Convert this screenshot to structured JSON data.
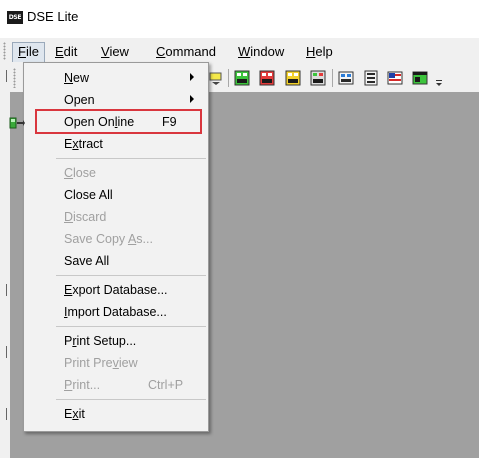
{
  "window": {
    "logo_text": "DSE",
    "title": "DSE Lite"
  },
  "menubar": {
    "items": [
      {
        "label": "File",
        "mnemonic": "F"
      },
      {
        "label": "Edit",
        "mnemonic": "E"
      },
      {
        "label": "View",
        "mnemonic": "V"
      },
      {
        "label": "Command",
        "mnemonic": "C"
      },
      {
        "label": "Window",
        "mnemonic": "W"
      },
      {
        "label": "Help",
        "mnemonic": "H"
      }
    ]
  },
  "file_menu": {
    "items": [
      {
        "label": "New",
        "mnemonic": "N",
        "submenu": true,
        "enabled": true
      },
      {
        "label": "Open",
        "submenu": true,
        "enabled": true
      },
      {
        "label": "Open Online",
        "mnemonic_index": 8,
        "shortcut": "F9",
        "enabled": true,
        "highlighted": true,
        "icon": "open-online-icon"
      },
      {
        "label": "Extract",
        "mnemonic_index": 1,
        "enabled": true
      },
      {
        "label": "Close",
        "mnemonic_index": 0,
        "enabled": false
      },
      {
        "label": "Close All",
        "enabled": true
      },
      {
        "label": "Discard",
        "mnemonic_index": 0,
        "enabled": false
      },
      {
        "label": "Save Copy As...",
        "mnemonic_index": 10,
        "enabled": false
      },
      {
        "label": "Save All",
        "enabled": true
      },
      {
        "label": "Export Database...",
        "mnemonic_index": 0,
        "enabled": true
      },
      {
        "label": "Import Database...",
        "mnemonic_index": 0,
        "enabled": true
      },
      {
        "label": "Print Setup...",
        "mnemonic_index": 1,
        "enabled": true
      },
      {
        "label": "Print Preview",
        "mnemonic_index": 11,
        "enabled": false
      },
      {
        "label": "Print...",
        "mnemonic_index": 0,
        "shortcut": "Ctrl+P",
        "enabled": false
      },
      {
        "label": "Exit",
        "mnemonic_index": 1,
        "enabled": true
      }
    ]
  },
  "colors": {
    "highlight_border": "#d9363e",
    "mdi_background": "#a0a0a0",
    "menu_background": "#f2f2f2",
    "disabled_text": "#a0a0a0"
  }
}
